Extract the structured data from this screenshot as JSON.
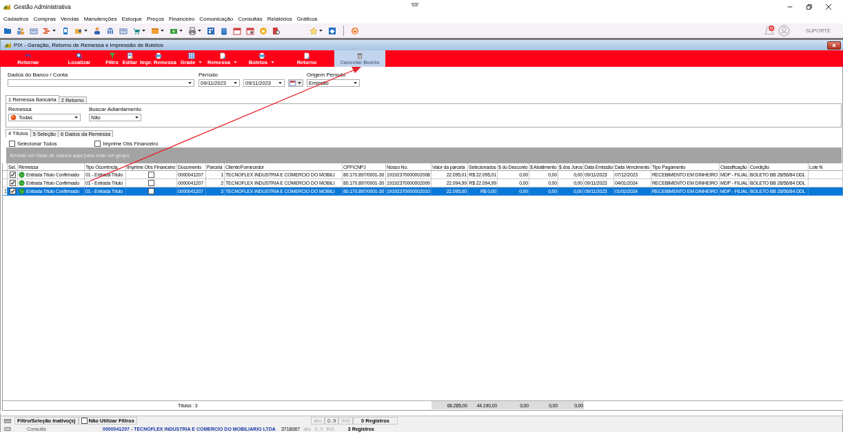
{
  "app": {
    "title": "Gestão Administrativa"
  },
  "menu": [
    "Cadastros",
    "Compras",
    "Vendas",
    "Manutenções",
    "Estoque",
    "Preços",
    "Financeiro",
    "Comunicação",
    "Consultas",
    "Relatórios",
    "Gráficos"
  ],
  "support": "SUPORTE",
  "window": {
    "title": "PIX - Geração, Retorno de Remessa e Impressão de Boletos"
  },
  "actions": [
    {
      "label": "Retornar",
      "dropdown": false,
      "disabled": false
    },
    {
      "label": "Localizar",
      "dropdown": false,
      "disabled": false
    },
    {
      "label": "Filtro",
      "dropdown": false,
      "disabled": false
    },
    {
      "label": "Editar",
      "dropdown": false,
      "disabled": false
    },
    {
      "label": "Impr. Remessa",
      "dropdown": false,
      "disabled": false
    },
    {
      "label": "Grade",
      "dropdown": true,
      "disabled": false
    },
    {
      "label": "Remessa",
      "dropdown": true,
      "disabled": false
    },
    {
      "label": "Boletos",
      "dropdown": true,
      "disabled": false
    },
    {
      "label": "Retorno",
      "dropdown": false,
      "disabled": false
    },
    {
      "label": "Cancelar Boleto",
      "dropdown": false,
      "disabled": true
    }
  ],
  "filters": {
    "bank": {
      "label": "Dados do Banco / Conta"
    },
    "period": {
      "label": "Período",
      "from": "09/11/2023",
      "to": "09/11/2023"
    },
    "origin": {
      "label": "Origem Período",
      "value": "Emissão"
    }
  },
  "tabs": [
    {
      "label": "1 Remessa Bancária",
      "selected": true
    },
    {
      "label": "2 Retorno",
      "selected": false
    }
  ],
  "remessa": {
    "label": "Remessa",
    "value": "Todas"
  },
  "adiantamento": {
    "label": "Buscar Adiantamento",
    "value": "Não"
  },
  "subtabs": [
    {
      "label": "4 Títulos",
      "selected": true
    },
    {
      "label": "5 Seleção",
      "selected": false
    },
    {
      "label": "6 Dados da Remessa",
      "selected": false
    }
  ],
  "options": [
    {
      "label": "Selecionar Todos",
      "checked": false
    },
    {
      "label": "Imprime Obs Financeiro",
      "checked": false
    }
  ],
  "group_hint": "Arraste um título de coluna aqui para criar um grupo",
  "table": {
    "columns": [
      {
        "title": "Sel.",
        "kind": "check"
      },
      {
        "title": "Remessa",
        "kind": "status"
      },
      {
        "title": "Tipo Ocorrência",
        "kind": "text"
      },
      {
        "title": "Imprime Obs Financeiro",
        "kind": "check"
      },
      {
        "title": "Documento",
        "kind": "text",
        "footer": "Títulos : 3"
      },
      {
        "title": "Parcela",
        "kind": "number"
      },
      {
        "title": "Cliente/Fornecedor",
        "kind": "text"
      },
      {
        "title": "CPF\\CNPJ",
        "kind": "text"
      },
      {
        "title": "Nosso No.",
        "kind": "text"
      },
      {
        "title": "Valor da parcela",
        "kind": "number",
        "footer": "66.285,00"
      },
      {
        "title": "Selecionados",
        "kind": "number",
        "footer": "44.190,00"
      },
      {
        "title": "$ do Desconto",
        "kind": "number",
        "footer": "0,00"
      },
      {
        "title": "$ Abatimento",
        "kind": "number",
        "footer": "0,00"
      },
      {
        "title": "$ dos Juros",
        "kind": "number",
        "footer": "0,00"
      },
      {
        "title": "Data Emissão",
        "kind": "text"
      },
      {
        "title": "Data Vencimento",
        "kind": "text"
      },
      {
        "title": "Tipo Pagamento",
        "kind": "text"
      },
      {
        "title": "Classificação",
        "kind": "text"
      },
      {
        "title": "Condição",
        "kind": "text"
      },
      {
        "title": "Lote N",
        "kind": "text"
      }
    ],
    "rows": [
      {
        "selected": false,
        "values": [
          true,
          "Entrada Título Confirmado",
          "01 - Entrada Título",
          false,
          "0000041207",
          "1",
          "TECNOFLEX INDUSTRIA E COMERCIO DO MOBILI",
          "80.170.897/0001-30",
          "19192370000002008",
          "22.095,01",
          "R$ 22.095,01",
          "0,00",
          "0,00",
          "0,00",
          "09/11/2023",
          "07/12/2023",
          "RECEBIMENTO EM DINHEIRO",
          "MDP - FILIAL",
          "BOLETO BB 28/56/84 DDL"
        ]
      },
      {
        "selected": false,
        "values": [
          true,
          "Entrada Título Confirmado",
          "01 - Entrada Título",
          false,
          "0000041207",
          "2",
          "TECNOFLEX INDUSTRIA E COMERCIO DO MOBILI",
          "80.170.897/0001-30",
          "19192370000002009",
          "22.094,99",
          "R$ 22.094,99",
          "0,00",
          "0,00",
          "0,00",
          "09/11/2023",
          "04/01/2024",
          "RECEBIMENTO EM DINHEIRO",
          "MDP - FILIAL",
          "BOLETO BB 28/56/84 DDL"
        ]
      },
      {
        "selected": true,
        "values": [
          true,
          "Entrada Título Confirmado",
          "01 - Entrada Título",
          false,
          "0000041207",
          "3",
          "TECNOFLEX INDUSTRIA E COMERCIO DO MOBILI",
          "80.170.897/0001-30",
          "19192370000002010",
          "22.095,00",
          "R$ 0,00",
          "0,00",
          "0,00",
          "0,00",
          "09/11/2023",
          "01/02/2024",
          "RECEBIMENTO EM DINHEIRO",
          "MDP - FILIAL",
          "BOLETO BB 28/56/84 DDL"
        ]
      }
    ]
  },
  "status": {
    "filter_state": "Filtro/Seleção Inativo(s)",
    "no_filters": {
      "label": "Não Utilizar Filtros",
      "checked": false
    },
    "indicators": [
      {
        "label": "abc",
        "disabled": true
      },
      {
        "label": "0..9",
        "disabled": false
      },
      {
        "label": "INS",
        "disabled": true
      }
    ],
    "records": "0 Registros"
  },
  "background_status": {
    "mode": "Consulta",
    "record": "0000041207 - TECNOFLEX INDUSTRIA E COMERCIO DO MOBILIARIO LTDA",
    "code": "3718087",
    "indicators": [
      {
        "label": "abc",
        "disabled": true
      },
      {
        "label": "0..9",
        "disabled": true
      },
      {
        "label": "INS",
        "disabled": true
      }
    ],
    "records": "3 Registros"
  }
}
